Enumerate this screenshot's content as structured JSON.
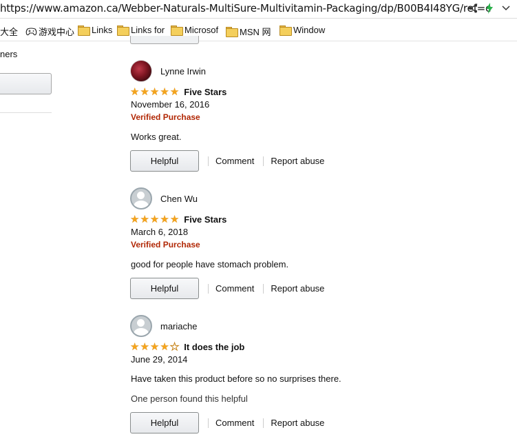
{
  "browser": {
    "url": "https://www.amazon.ca/Webber-Naturals-MultiSure-Multivitamin-Packaging/dp/B00B4I48YG/ref=c",
    "bookmarks": [
      {
        "label": "大全",
        "icon": "globe-icon"
      },
      {
        "label": "游戏中心",
        "icon": "gamepad-icon"
      },
      {
        "label": "Links",
        "icon": "folder-icon"
      },
      {
        "label": "Links for",
        "icon": "folder-icon"
      },
      {
        "label": "Microsof",
        "icon": "folder-icon"
      },
      {
        "label": "MSN 网",
        "icon": "folder-icon"
      },
      {
        "label": "Window",
        "icon": "folder-icon"
      }
    ]
  },
  "left_column": {
    "text": "ners"
  },
  "reviews": [
    {
      "reviewer": "Lynne Irwin",
      "avatar": "photo",
      "stars": 5,
      "title": "Five Stars",
      "date": "November 16, 2016",
      "verified": "Verified Purchase",
      "body": "Works great.",
      "found_helpful": "",
      "helpful_label": "Helpful",
      "comment_label": "Comment",
      "report_label": "Report abuse"
    },
    {
      "reviewer": "Chen Wu",
      "avatar": "default",
      "stars": 5,
      "title": "Five Stars",
      "date": "March 6, 2018",
      "verified": "Verified Purchase",
      "body": "good for people have stomach problem.",
      "found_helpful": "",
      "helpful_label": "Helpful",
      "comment_label": "Comment",
      "report_label": "Report abuse"
    },
    {
      "reviewer": "mariache",
      "avatar": "default",
      "stars": 4,
      "title": "It does the job",
      "date": "June 29, 2014",
      "verified": "",
      "body": "Have taken this product before so no surprises there.",
      "found_helpful": "One person found this helpful",
      "helpful_label": "Helpful",
      "comment_label": "Comment",
      "report_label": "Report abuse"
    }
  ],
  "colors": {
    "star": "#f4a41d",
    "verified": "#b12704"
  }
}
